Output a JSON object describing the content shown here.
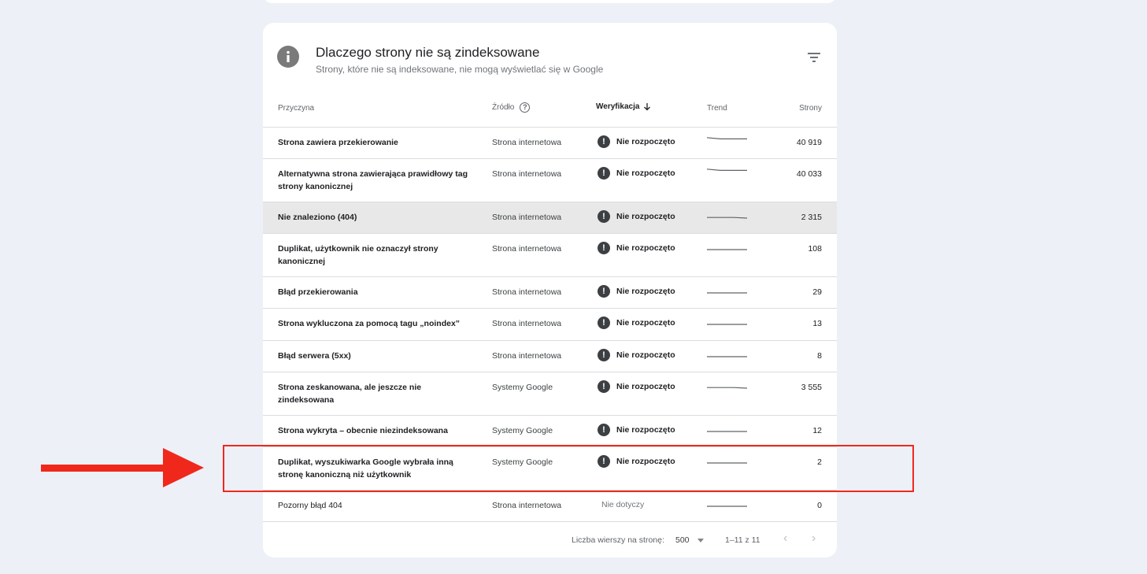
{
  "card": {
    "title": "Dlaczego strony nie są zindeksowane",
    "subtitle": "Strony, które nie są indeksowane, nie mogą wyświetlać się w Google"
  },
  "table": {
    "headers": {
      "reason": "Przyczyna",
      "source": "Źródło",
      "verification": "Weryfikacja",
      "trend": "Trend",
      "pages": "Strony"
    },
    "rows": [
      {
        "reason": "Strona zawiera przekierowanie",
        "source": "Strona internetowa",
        "verification": "Nie rozpoczęto",
        "pages": "40 919",
        "trend": [
          0.9,
          0.7,
          0.7,
          0.7
        ]
      },
      {
        "reason": "Alternatywna strona zawierająca prawidłowy tag strony kanonicznej",
        "source": "Strona internetowa",
        "verification": "Nie rozpoczęto",
        "pages": "40 033",
        "trend": [
          0.9,
          0.7,
          0.7,
          0.7
        ]
      },
      {
        "reason": "Nie znaleziono (404)",
        "source": "Strona internetowa",
        "verification": "Nie rozpoczęto",
        "pages": "2 315",
        "trend": [
          0.1,
          0.1,
          0.1,
          0.0
        ]
      },
      {
        "reason": "Duplikat, użytkownik nie oznaczył strony kanonicznej",
        "source": "Strona internetowa",
        "verification": "Nie rozpoczęto",
        "pages": "108",
        "trend": [
          0.0,
          0.0,
          0.0,
          0.0
        ]
      },
      {
        "reason": "Błąd przekierowania",
        "source": "Strona internetowa",
        "verification": "Nie rozpoczęto",
        "pages": "29",
        "trend": [
          0.0,
          0.0,
          0.0,
          0.0
        ]
      },
      {
        "reason": "Strona wykluczona za pomocą tagu „noindex”",
        "source": "Strona internetowa",
        "verification": "Nie rozpoczęto",
        "pages": "13",
        "trend": [
          0.0,
          0.0,
          0.0,
          0.0
        ]
      },
      {
        "reason": "Błąd serwera (5xx)",
        "source": "Strona internetowa",
        "verification": "Nie rozpoczęto",
        "pages": "8",
        "trend": [
          0.0,
          0.0,
          0.0,
          0.0
        ]
      },
      {
        "reason": "Strona zeskanowana, ale jeszcze nie zindeksowana",
        "source": "Systemy Google",
        "verification": "Nie rozpoczęto",
        "pages": "3 555",
        "trend": [
          0.1,
          0.1,
          0.1,
          0.0
        ]
      },
      {
        "reason": "Strona wykryta – obecnie niezindeksowana",
        "source": "Systemy Google",
        "verification": "Nie rozpoczęto",
        "pages": "12",
        "trend": [
          0.0,
          0.0,
          0.0,
          0.0
        ]
      },
      {
        "reason": "Duplikat, wyszukiwarka Google wybrała inną stronę kanoniczną niż użytkownik",
        "source": "Systemy Google",
        "verification": "Nie rozpoczęto",
        "pages": "2",
        "trend": [
          0.0,
          0.0,
          0.0,
          0.0
        ]
      },
      {
        "reason": "Pozorny błąd 404",
        "source": "Strona internetowa",
        "verification": "Nie dotyczy",
        "pages": "0",
        "trend": [
          0.0,
          0.0,
          0.0,
          0.0
        ]
      }
    ]
  },
  "footer": {
    "rows_per_page_label": "Liczba wierszy na stronę:",
    "rows_per_page_value": "500",
    "range": "1–11 z 11"
  },
  "icons": {
    "info": "info-icon",
    "filter": "filter-icon",
    "help": "help-icon",
    "sort": "arrow-down-icon",
    "warning": "exclamation-circle-icon",
    "prev": "chevron-left-icon",
    "next": "chevron-right-icon",
    "annotation_arrow": "red-arrow-icon"
  },
  "colors": {
    "annotation": "#f0281b",
    "background": "#eef0f8",
    "selected_row": "#e8e8e8"
  }
}
